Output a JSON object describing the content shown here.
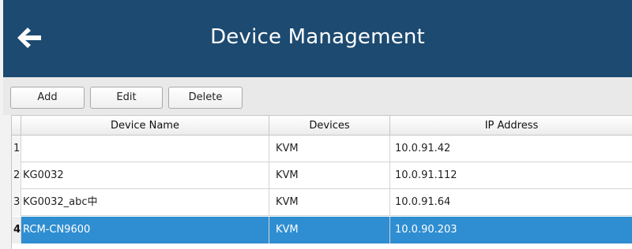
{
  "header": {
    "title": "Device Management",
    "back_icon": "arrow-left-icon",
    "background": "#1d4a70"
  },
  "toolbar": {
    "add_label": "Add",
    "edit_label": "Edit",
    "delete_label": "Delete"
  },
  "table": {
    "columns": [
      "Device Name",
      "Devices",
      "IP Address"
    ],
    "rows": [
      {
        "num": "1",
        "name": "",
        "devices": "KVM",
        "ip": "10.0.91.42"
      },
      {
        "num": "2",
        "name": "KG0032",
        "devices": "KVM",
        "ip": "10.0.91.112"
      },
      {
        "num": "3",
        "name": "KG0032_abc中",
        "devices": "KVM",
        "ip": "10.0.91.64"
      },
      {
        "num": "4",
        "name": "RCM-CN9600",
        "devices": "KVM",
        "ip": "10.0.90.203"
      }
    ],
    "selected_row": 4,
    "selection_color": "#2f8ed1"
  }
}
